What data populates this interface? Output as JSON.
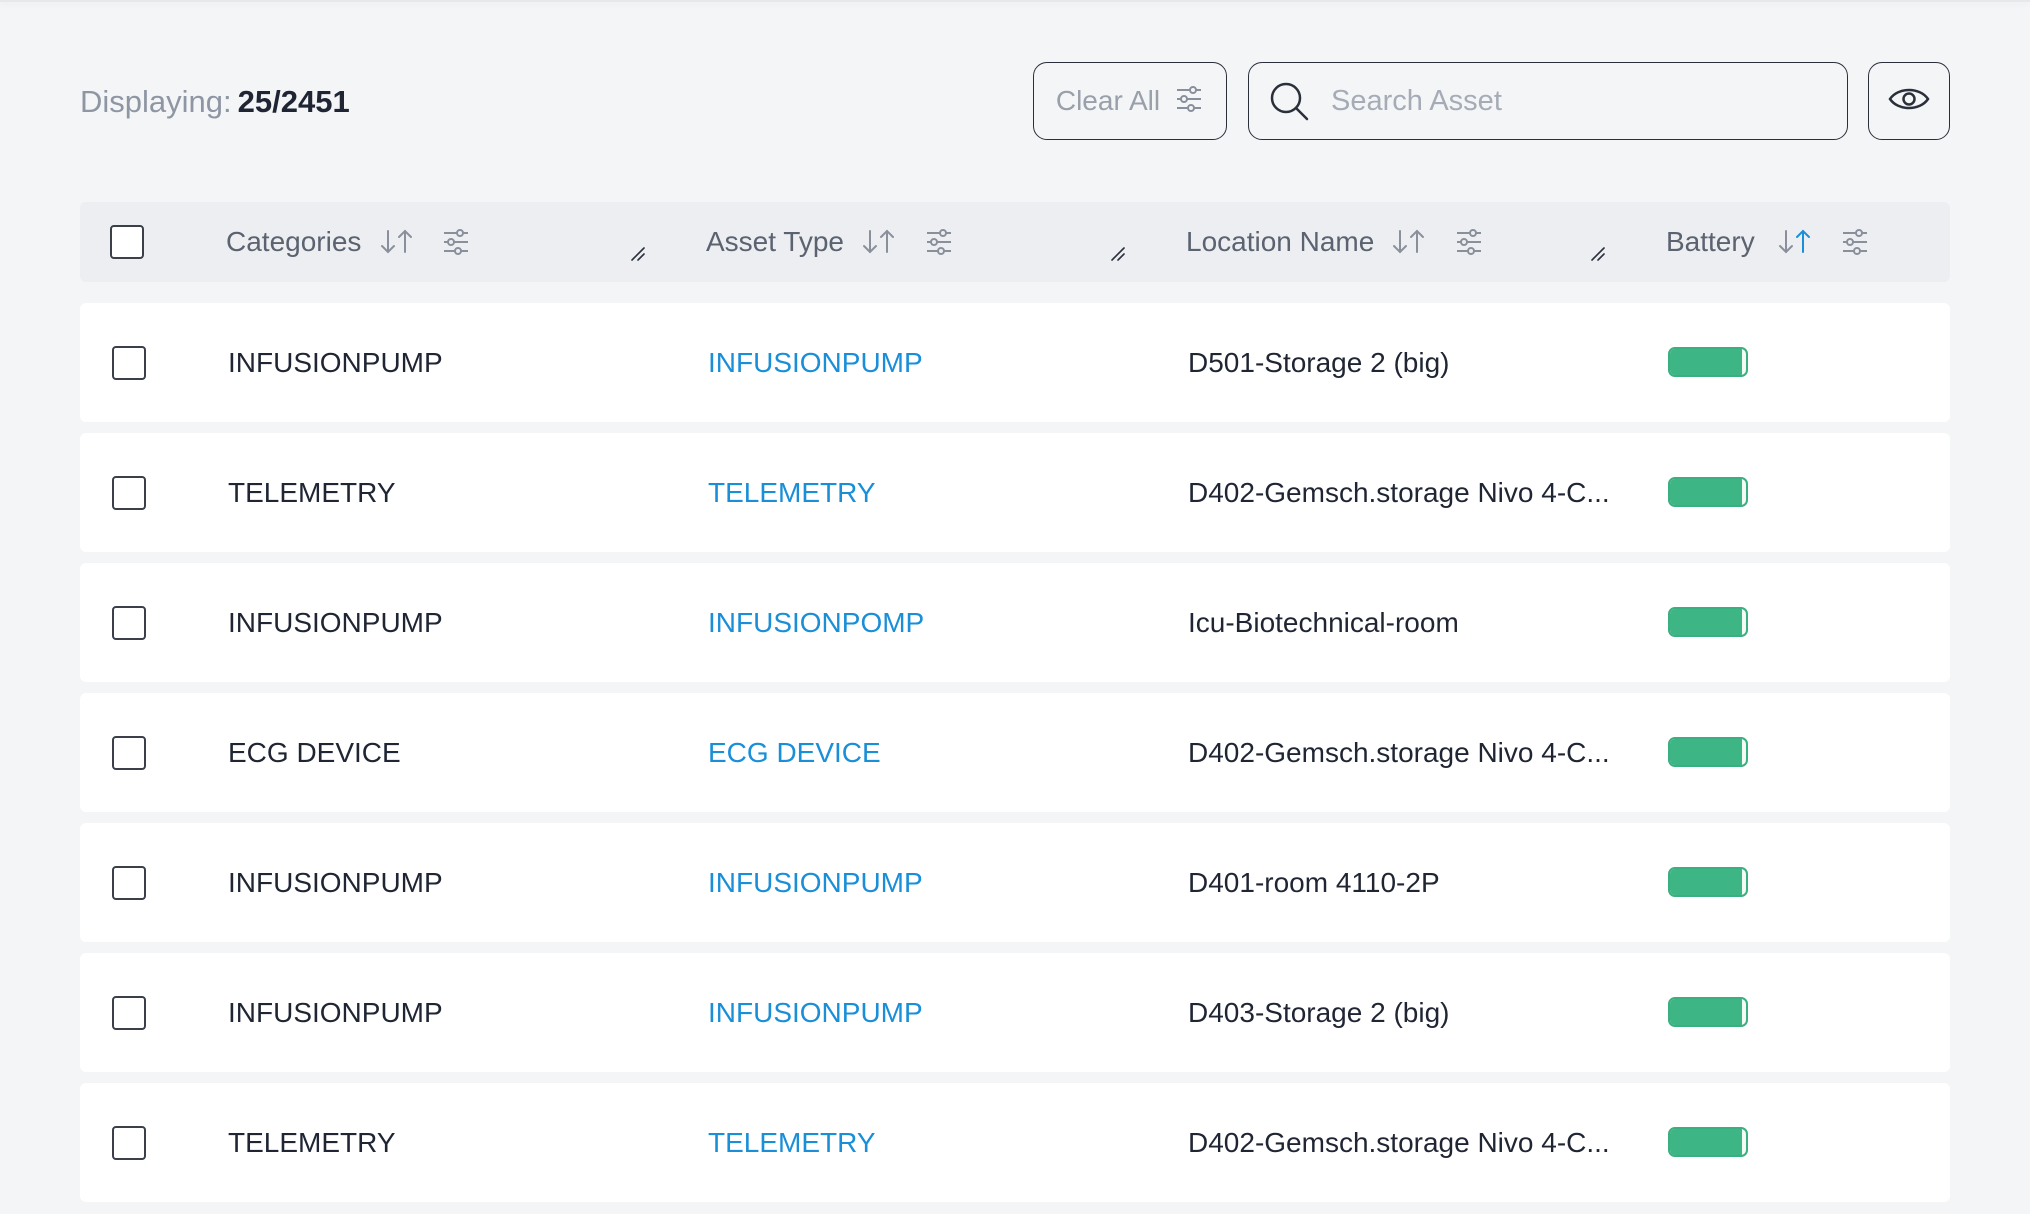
{
  "toolbar": {
    "displaying_label": "Displaying:",
    "displaying_count": "25/2451",
    "clear_all_label": "Clear All",
    "search_placeholder": "Search Asset",
    "search_value": ""
  },
  "table": {
    "columns": [
      {
        "label": "Categories"
      },
      {
        "label": "Asset Type"
      },
      {
        "label": "Location Name"
      },
      {
        "label": "Battery"
      }
    ],
    "active_sort_column": "Battery",
    "rows": [
      {
        "category": "INFUSIONPUMP",
        "asset_type": "INFUSIONPUMP",
        "location": "D501-Storage 2 (big)",
        "battery": 0.95
      },
      {
        "category": "TELEMETRY",
        "asset_type": "TELEMETRY",
        "location": "D402-Gemsch.storage Nivo 4-C...",
        "battery": 0.95
      },
      {
        "category": "INFUSIONPUMP",
        "asset_type": "INFUSIONPOMP",
        "location": "Icu-Biotechnical-room",
        "battery": 0.95
      },
      {
        "category": "ECG DEVICE",
        "asset_type": "ECG DEVICE",
        "location": "D402-Gemsch.storage Nivo 4-C...",
        "battery": 0.95
      },
      {
        "category": "INFUSIONPUMP",
        "asset_type": "INFUSIONPUMP",
        "location": "D401-room 4110-2P",
        "battery": 0.95
      },
      {
        "category": "INFUSIONPUMP",
        "asset_type": "INFUSIONPUMP",
        "location": "D403-Storage 2 (big)",
        "battery": 0.95
      },
      {
        "category": "TELEMETRY",
        "asset_type": "TELEMETRY",
        "location": "D402-Gemsch.storage Nivo 4-C...",
        "battery": 0.95
      }
    ]
  },
  "colors": {
    "accent_link": "#1a8fd8",
    "battery_good": "#3db584",
    "page_bg": "#f4f5f7"
  },
  "icons": {
    "clear_all": "sliders-icon",
    "search": "search-icon",
    "columns_visibility": "eye-icon",
    "sort": "sort-arrows-icon",
    "filter": "filter-sliders-icon",
    "resize": "column-resize-icon"
  }
}
